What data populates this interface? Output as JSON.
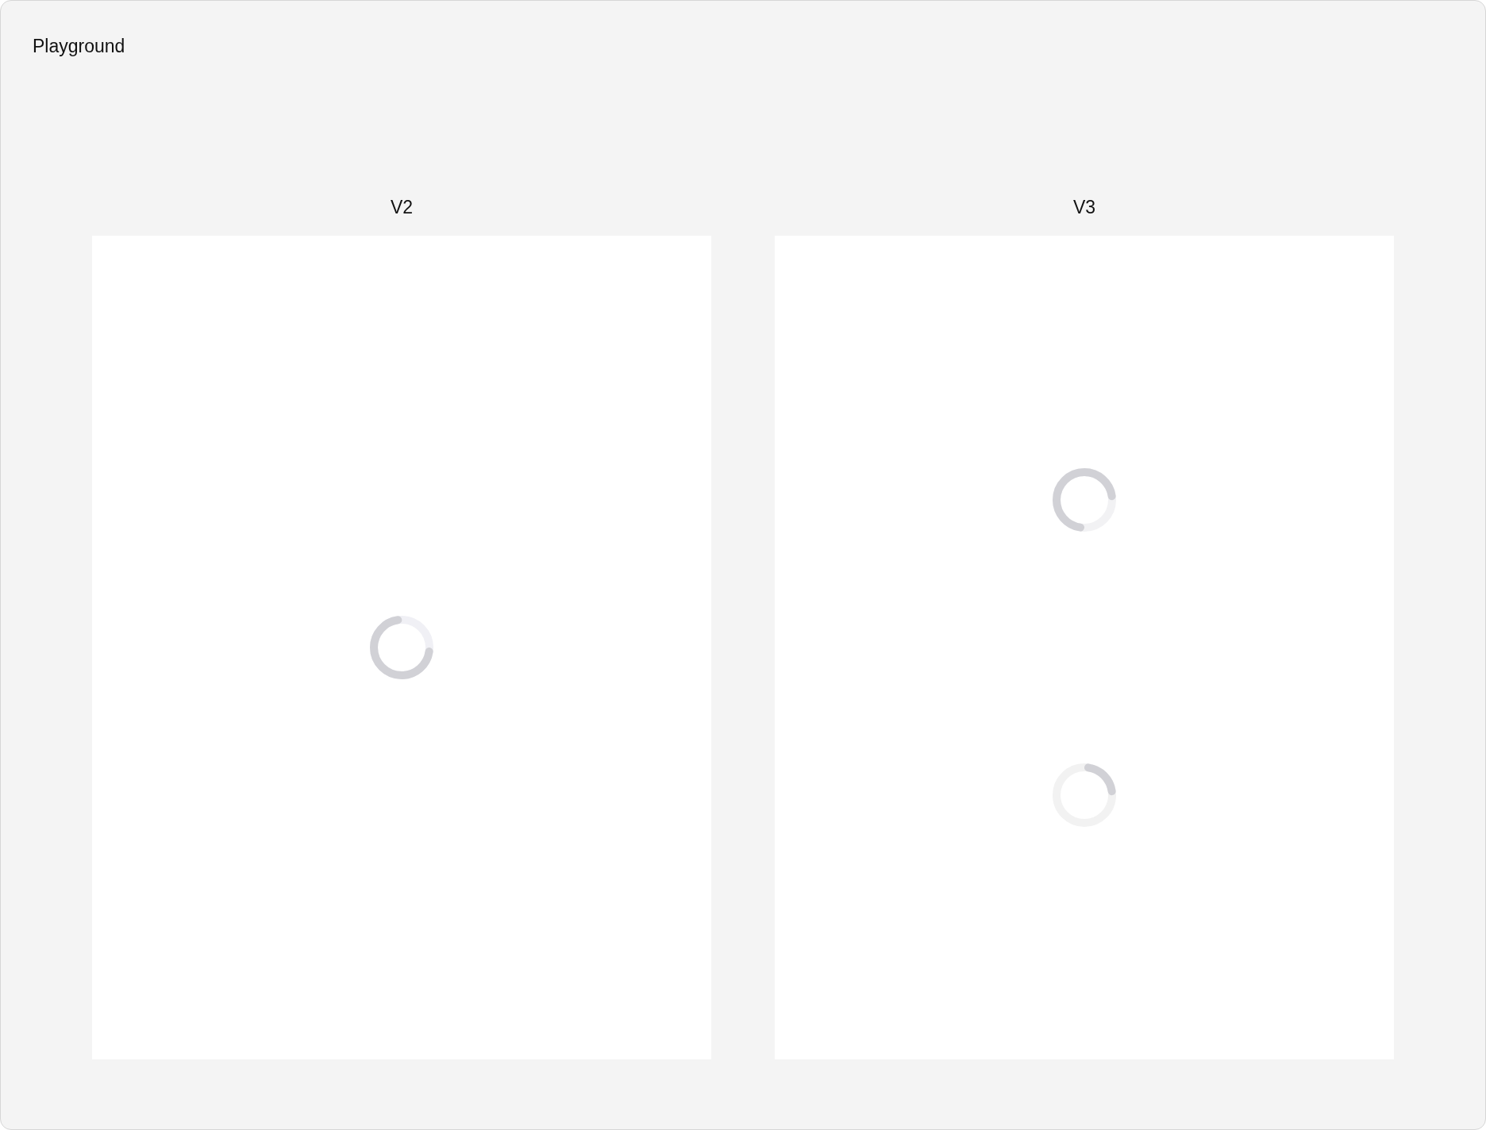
{
  "window": {
    "title": "Playground"
  },
  "panels": [
    {
      "label": "V2",
      "spinners": [
        {
          "kind": "wide-arc"
        }
      ]
    },
    {
      "label": "V3",
      "spinners": [
        {
          "kind": "wide-arc-turned"
        },
        {
          "kind": "short-arc"
        }
      ]
    }
  ]
}
